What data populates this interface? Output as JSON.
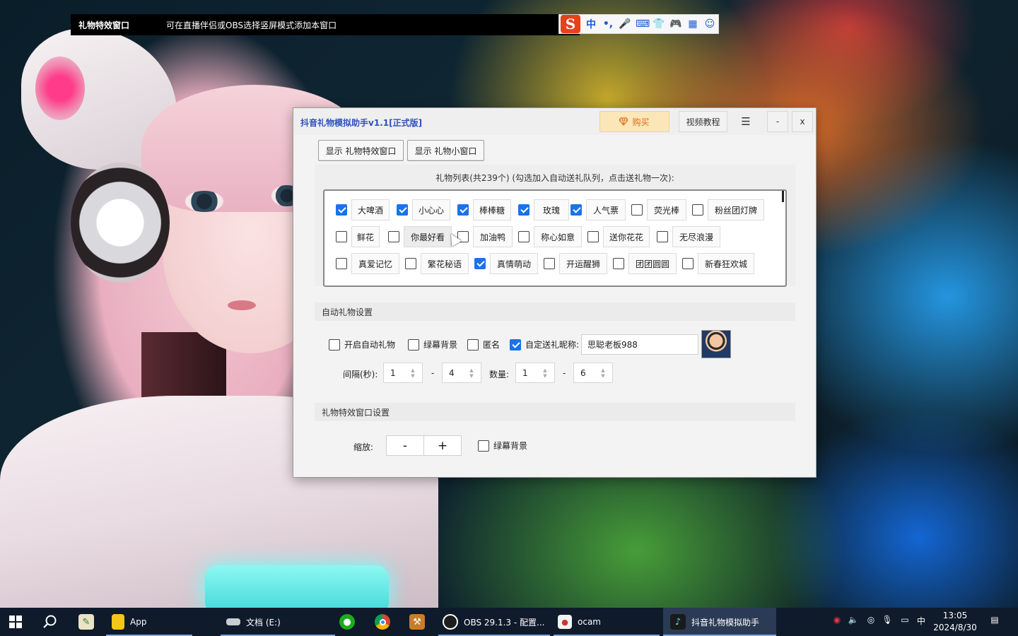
{
  "effect_bar": {
    "title": "礼物特效窗口",
    "hint": "可在直播伴侣或OBS选择竖屏模式添加本窗口"
  },
  "ime": {
    "logo": "S",
    "items": [
      "中",
      "•,",
      "🎤",
      "⌨",
      "👕",
      "🎮",
      "▦",
      "☺"
    ]
  },
  "app": {
    "title": "抖音礼物模拟助手v1.1[正式版]",
    "buy_label": "购买",
    "video_label": "视频教程",
    "menu_glyph": "☰",
    "min_glyph": "-",
    "close_glyph": "x",
    "show_effect_label": "显示 礼物特效窗口",
    "show_small_label": "显示 礼物小窗口",
    "gift_caption": "礼物列表(共239个) (勾选加入自动送礼队列，点击送礼物一次):",
    "gift_rows": [
      [
        {
          "name": "大啤酒",
          "checked": true
        },
        {
          "name": "小心心",
          "checked": true
        },
        {
          "name": "棒棒糖",
          "checked": true
        },
        {
          "name": "玫瑰",
          "checked": true
        },
        {
          "name": "人气票",
          "checked": true
        },
        {
          "name": "荧光棒",
          "checked": false
        },
        {
          "name": "粉丝团灯牌",
          "checked": false
        }
      ],
      [
        {
          "name": "鲜花",
          "checked": false
        },
        {
          "name": "你最好看",
          "checked": false
        },
        {
          "name": "加油鸭",
          "checked": false
        },
        {
          "name": "称心如意",
          "checked": false
        },
        {
          "name": "送你花花",
          "checked": false
        },
        {
          "name": "无尽浪漫",
          "checked": false
        }
      ],
      [
        {
          "name": "真爱记忆",
          "checked": false
        },
        {
          "name": "繁花秘语",
          "checked": false
        },
        {
          "name": "真情萌动",
          "checked": true
        },
        {
          "name": "开运醒狮",
          "checked": false
        },
        {
          "name": "团团圆圆",
          "checked": false
        },
        {
          "name": "新春狂欢城",
          "checked": false
        }
      ]
    ],
    "auto_section": {
      "title": "自动礼物设置",
      "enable_label": "开启自动礼物",
      "enable_checked": false,
      "green_label": "绿幕背景",
      "green_checked": false,
      "anon_label": "匿名",
      "anon_checked": false,
      "custom_nick_label": "自定送礼昵称:",
      "custom_nick_checked": true,
      "nickname": "思聪老板988",
      "interval_label": "间隔(秒):",
      "interval_min": "1",
      "interval_max": "4",
      "dash": "-",
      "count_label": "数量:",
      "count_min": "1",
      "count_max": "6"
    },
    "fx_section": {
      "title": "礼物特效窗口设置",
      "zoom_label": "缩放:",
      "zoom_minus": "-",
      "zoom_plus": "+",
      "green_label": "绿幕背景",
      "green_checked": false
    }
  },
  "taskbar": {
    "items": [
      {
        "label": "App",
        "icon": "folder-icon"
      },
      {
        "label": "文档 (E:)",
        "icon": "drive-icon"
      },
      {
        "label": "OBS 29.1.3 - 配置...",
        "icon": "obs-icon"
      },
      {
        "label": "ocam",
        "icon": "ocam-icon"
      },
      {
        "label": "抖音礼物模拟助手",
        "icon": "douyin-icon"
      }
    ],
    "ime_indicator": "中",
    "time": "13:05",
    "date": "2024/8/30"
  },
  "colors": {
    "accent": "#1a73e8",
    "title_blue": "#2d52b8",
    "buy_bg": "#fbe6b8",
    "buy_text": "#e06a12",
    "taskbar": "#0f1a2b"
  }
}
